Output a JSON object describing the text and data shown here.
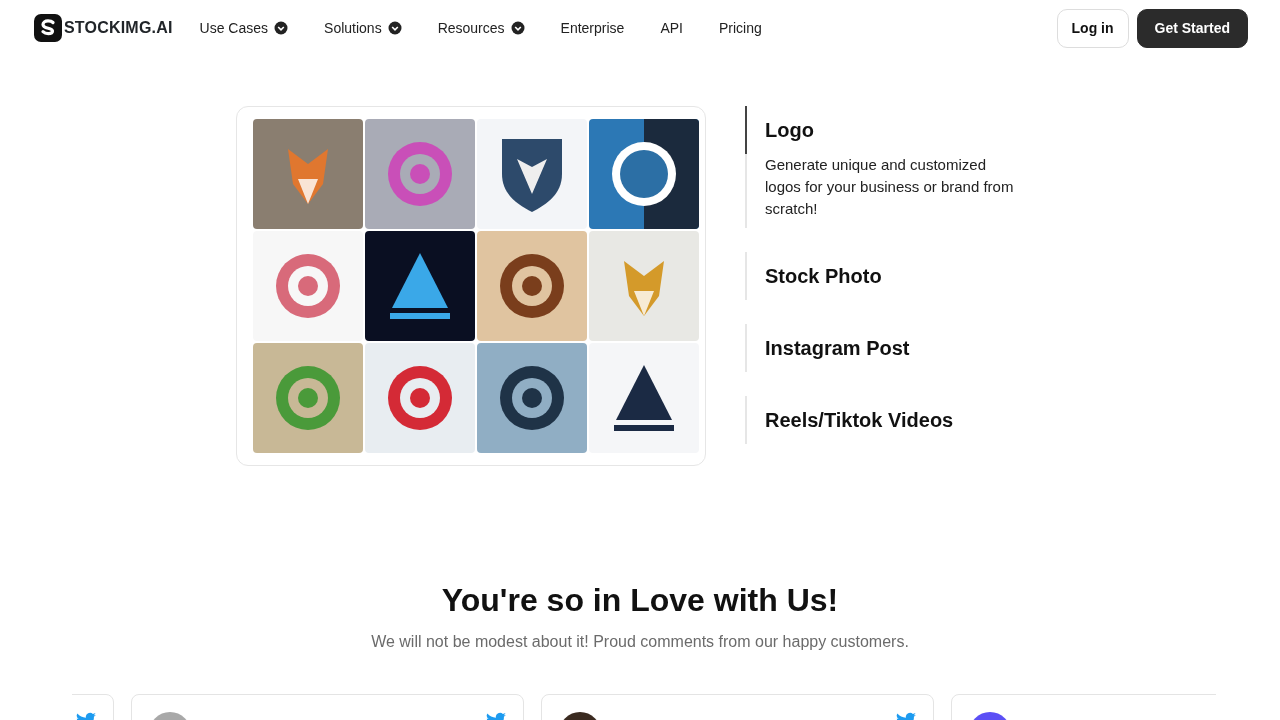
{
  "brand": {
    "name": "STOCKIMG.AI"
  },
  "nav": [
    {
      "label": "Use Cases",
      "dropdown": true
    },
    {
      "label": "Solutions",
      "dropdown": true
    },
    {
      "label": "Resources",
      "dropdown": true
    },
    {
      "label": "Enterprise",
      "dropdown": false
    },
    {
      "label": "API",
      "dropdown": false
    },
    {
      "label": "Pricing",
      "dropdown": false
    }
  ],
  "actions": [
    {
      "label": "Log in",
      "kind": "outline"
    },
    {
      "label": "Get Started",
      "kind": "dark"
    }
  ],
  "features": [
    {
      "title": "Logo",
      "selected": true,
      "description": "Generate unique and customized logos for your business or brand from scratch!"
    },
    {
      "title": "Stock Photo",
      "selected": false
    },
    {
      "title": "Instagram Post",
      "selected": false
    },
    {
      "title": "Reels/Tiktok Videos",
      "selected": false
    }
  ],
  "testimonials_section": {
    "heading": "You're so in Love with Us!",
    "subheading": "We will not be modest about it! Proud comments from our happy customers."
  },
  "testimonials": [
    {
      "kind": "clipped"
    },
    {
      "kind": "full",
      "color": "#a8a8a8"
    },
    {
      "kind": "full",
      "color": "#3a2a20"
    },
    {
      "kind": "cut",
      "color": "#5b4ff5"
    }
  ]
}
